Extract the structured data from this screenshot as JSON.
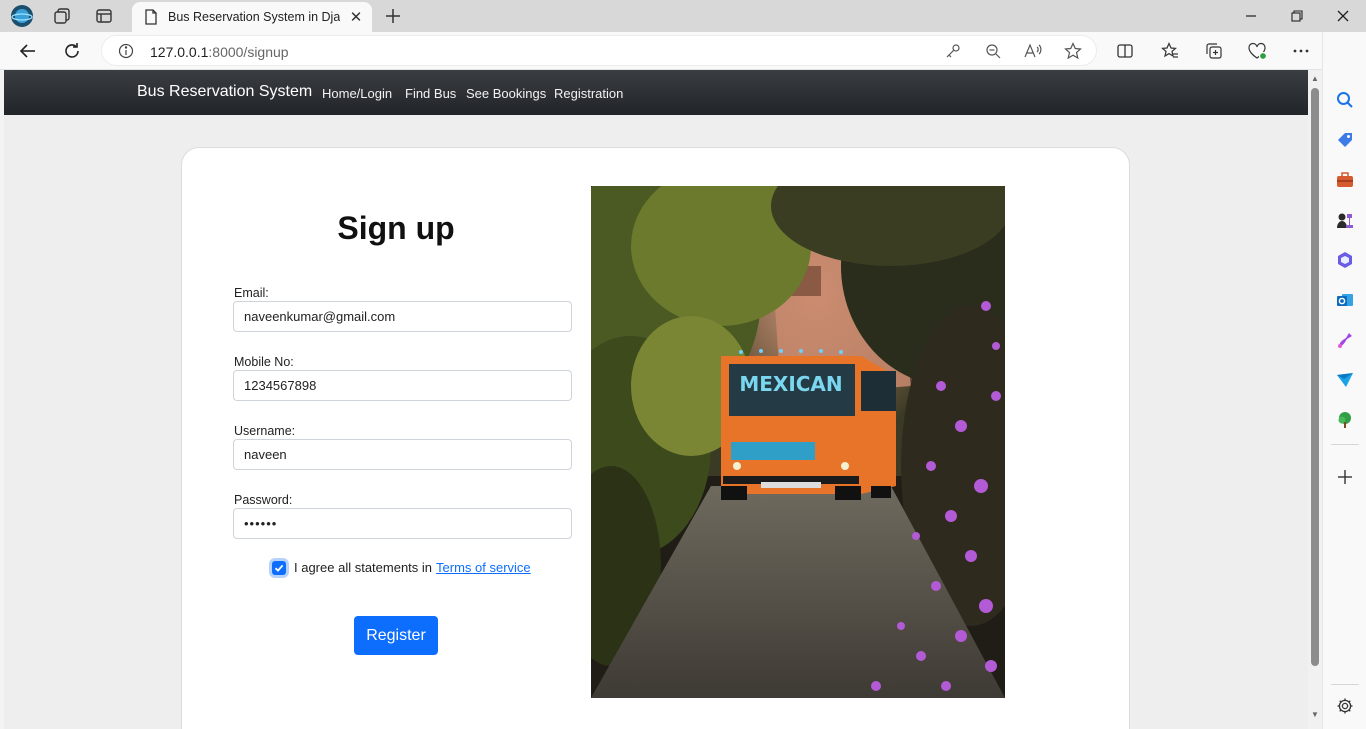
{
  "browser": {
    "tab_title": "Bus Reservation System in Django",
    "tab_close": "✕",
    "url_host": "127.0.0.1",
    "url_rest": ":8000/signup"
  },
  "site": {
    "brand": "Bus Reservation System",
    "nav": [
      "Home/Login",
      "Find Bus",
      "See Bookings",
      "Registration"
    ]
  },
  "form": {
    "title": "Sign up",
    "email_label": "Email:",
    "email_value": "naveenkumar@gmail.com",
    "mobile_label": "Mobile No:",
    "mobile_value": "1234567898",
    "username_label": "Username:",
    "username_value": "naveen",
    "password_label": "Password:",
    "password_value": "••••••",
    "agree_text": "I agree all statements in",
    "tos_link": "Terms of service",
    "agree_checked": true,
    "register_label": "Register"
  },
  "image": {
    "bus_text": "MEXICAN"
  },
  "colors": {
    "accent": "#0d6efd",
    "navbar": "#212529",
    "bus_orange": "#e8742a"
  }
}
